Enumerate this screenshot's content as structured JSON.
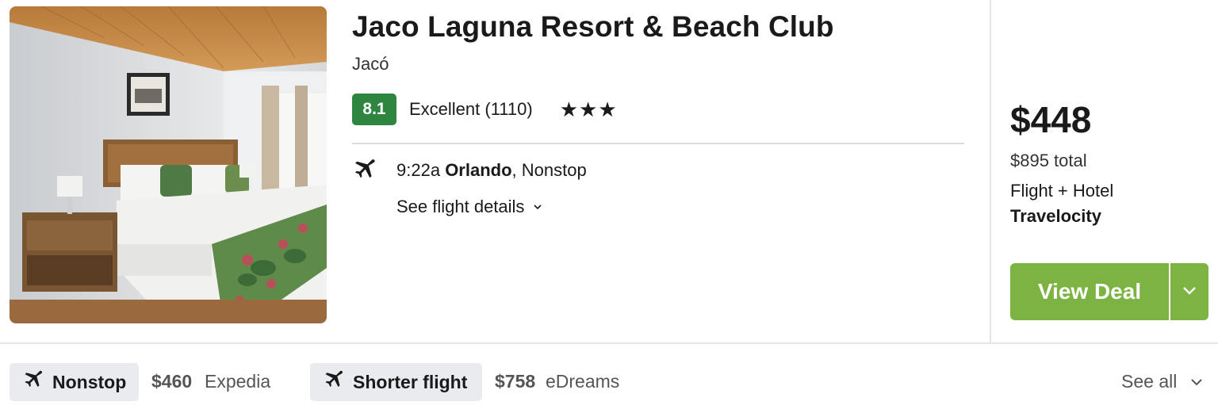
{
  "hotel": {
    "name": "Jaco Laguna Resort & Beach Club",
    "location": "Jacó",
    "score": "8.1",
    "rating_label": "Excellent (1110)",
    "stars": "★★★",
    "score_color": "#2e8540"
  },
  "flight": {
    "time": "9:22a",
    "origin": "Orlando",
    "stops": ", Nonstop",
    "details_link": "See flight details",
    "icon": "plane-icon"
  },
  "deal": {
    "price": "$448",
    "total": "$895 total",
    "package": "Flight + Hotel",
    "provider": "Travelocity",
    "button_label": "View Deal",
    "button_color": "#7cb342"
  },
  "alternatives": [
    {
      "tag": "Nonstop",
      "price": "$460",
      "site": "Expedia"
    },
    {
      "tag": "Shorter flight",
      "price": "$758",
      "site": "eDreams"
    }
  ],
  "see_all": "See all"
}
